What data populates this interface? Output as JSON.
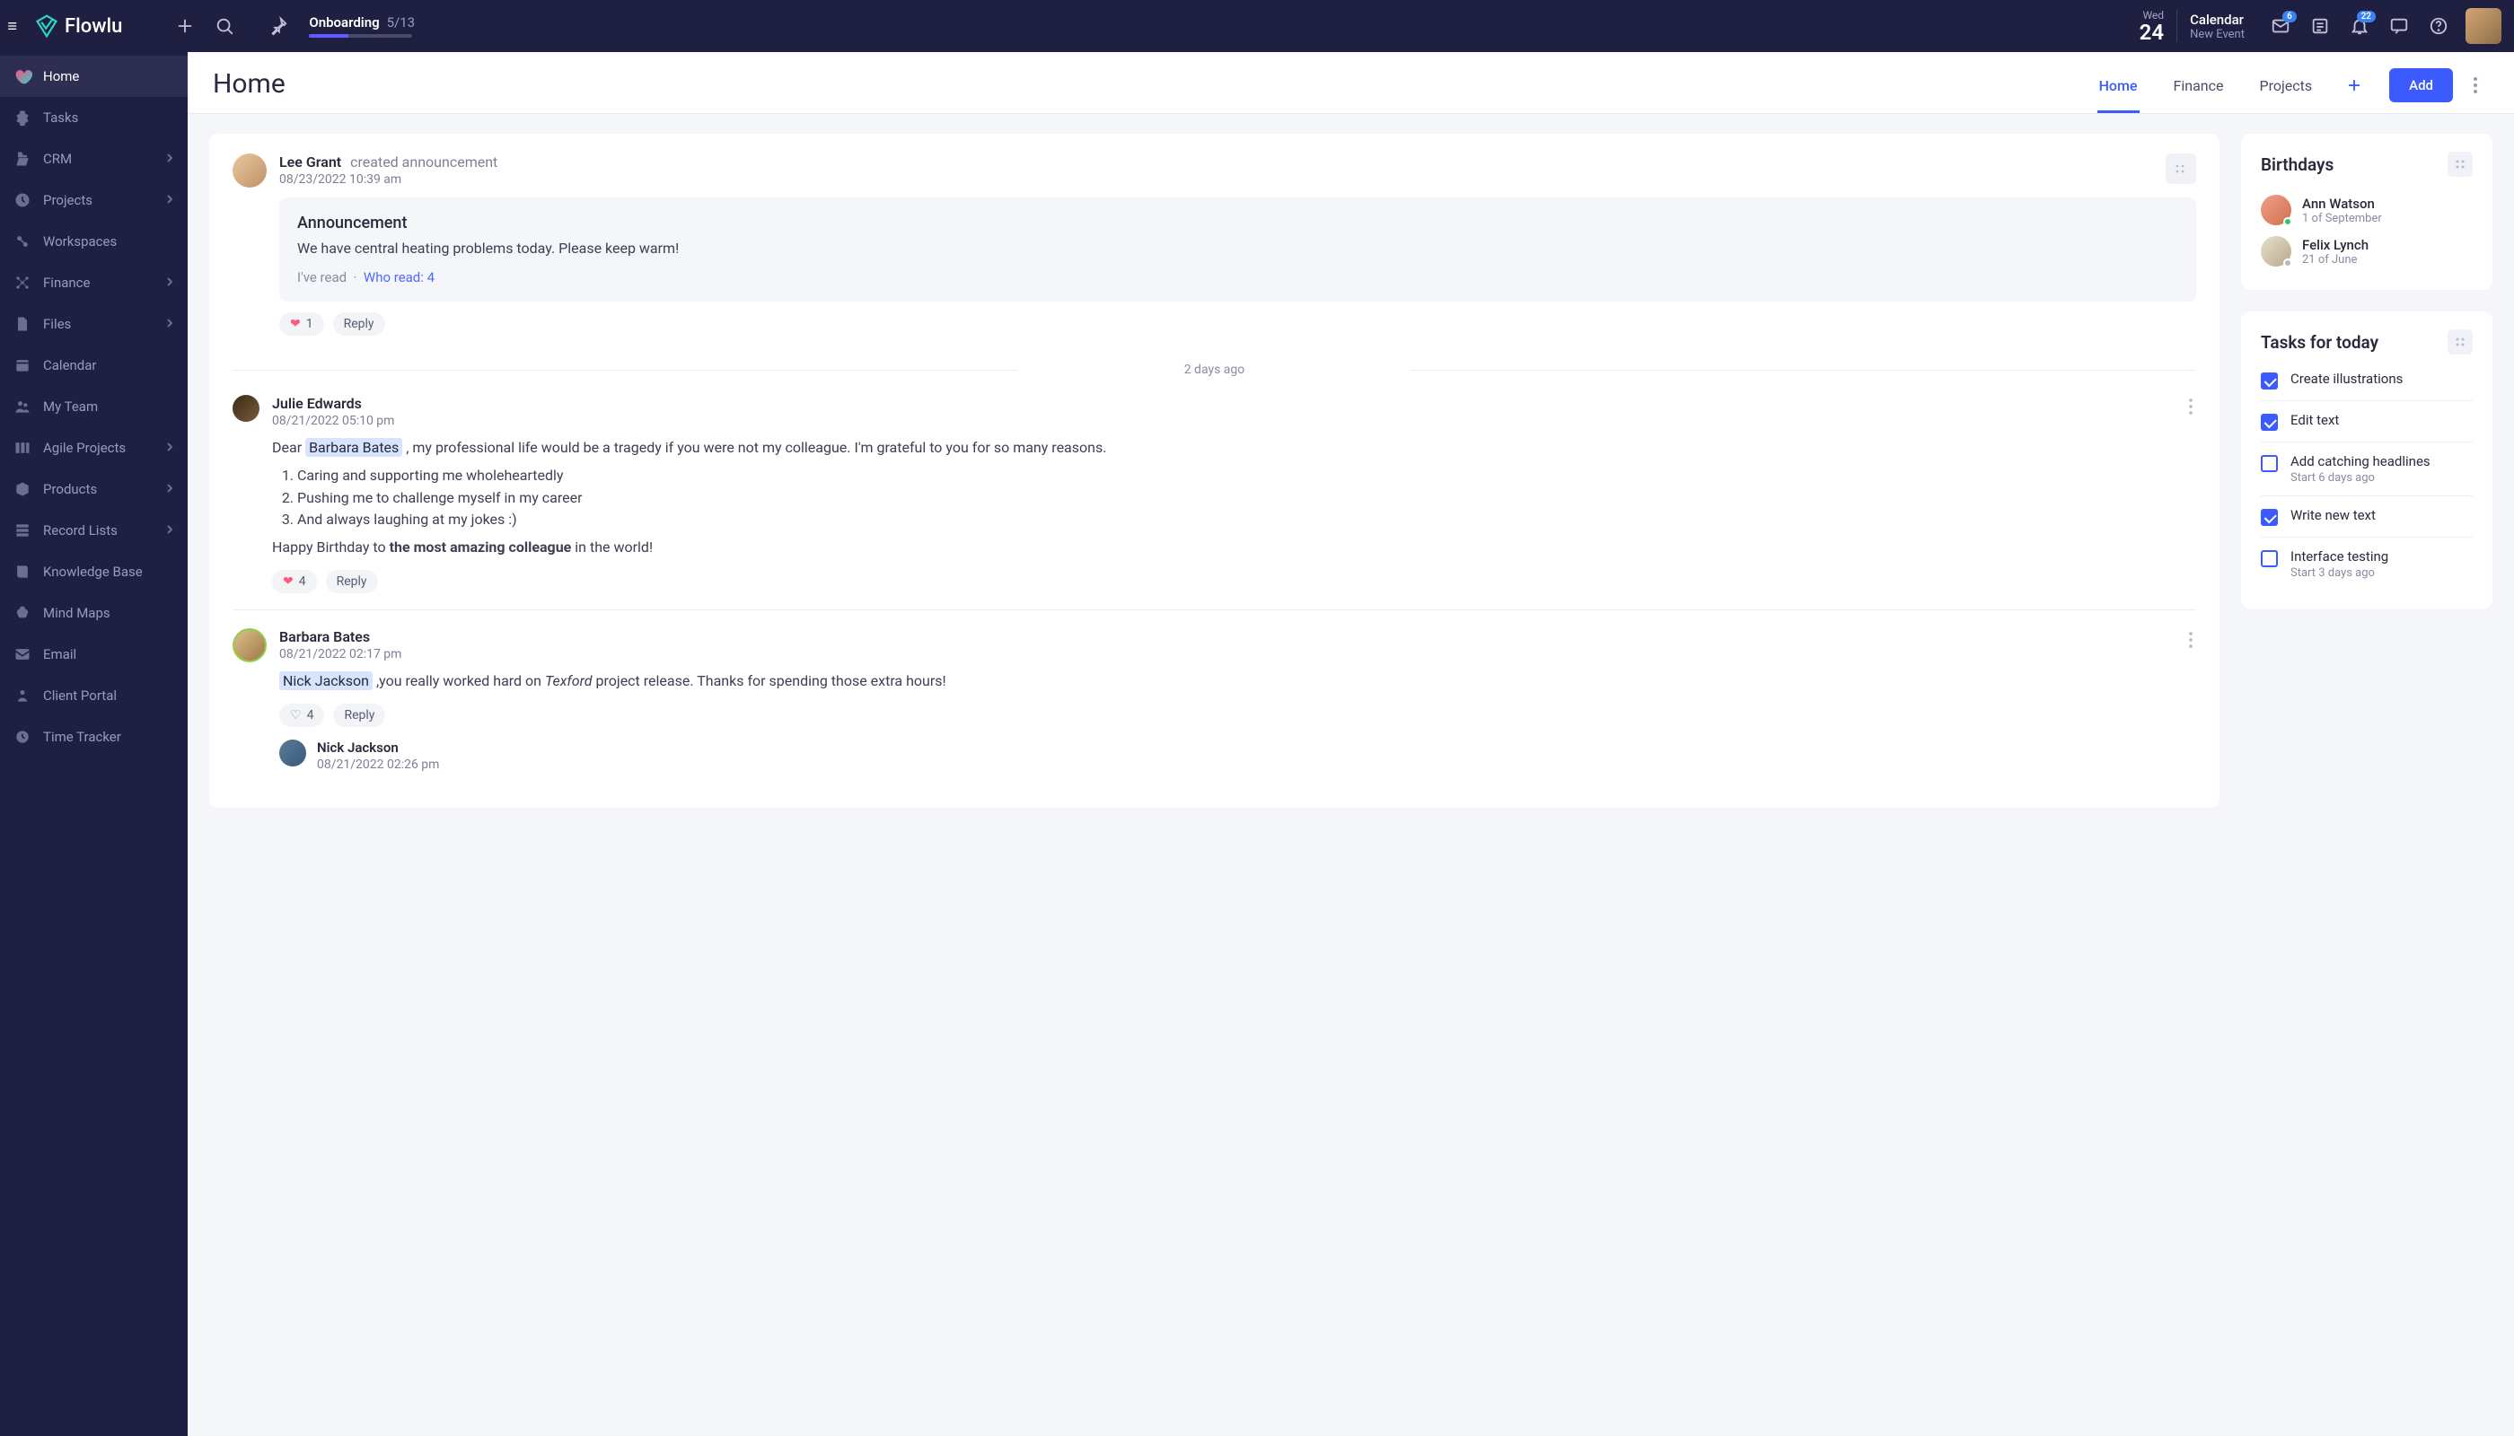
{
  "brand": "Flowlu",
  "onboarding": {
    "title": "Onboarding",
    "count": "5/13"
  },
  "date": {
    "dow": "Wed",
    "num": "24"
  },
  "calendar": {
    "title": "Calendar",
    "sub": "New Event"
  },
  "badges": {
    "inbox": "6",
    "bell": "22"
  },
  "nav": [
    {
      "label": "Home",
      "chev": false
    },
    {
      "label": "Tasks",
      "chev": false
    },
    {
      "label": "CRM",
      "chev": true
    },
    {
      "label": "Projects",
      "chev": true
    },
    {
      "label": "Workspaces",
      "chev": false
    },
    {
      "label": "Finance",
      "chev": true
    },
    {
      "label": "Files",
      "chev": true
    },
    {
      "label": "Calendar",
      "chev": false
    },
    {
      "label": "My Team",
      "chev": false
    },
    {
      "label": "Agile Projects",
      "chev": true
    },
    {
      "label": "Products",
      "chev": true
    },
    {
      "label": "Record Lists",
      "chev": true
    },
    {
      "label": "Knowledge Base",
      "chev": false
    },
    {
      "label": "Mind Maps",
      "chev": false
    },
    {
      "label": "Email",
      "chev": false
    },
    {
      "label": "Client Portal",
      "chev": false
    },
    {
      "label": "Time Tracker",
      "chev": false
    }
  ],
  "page": {
    "title": "Home",
    "tabs": [
      "Home",
      "Finance",
      "Projects"
    ],
    "add": "Add"
  },
  "feed": {
    "divider": "2 days ago",
    "posts": [
      {
        "author": "Lee Grant",
        "action": "created announcement",
        "time": "08/23/2022 10:39 am",
        "announce": {
          "title": "Announcement",
          "body": "We have central heating problems today. Please keep warm!",
          "read_label": "I've read",
          "who_read": "Who read: 4"
        },
        "likes": "1",
        "reply": "Reply"
      },
      {
        "author": "Julie Edwards",
        "time": "08/21/2022 05:10 pm",
        "mention": "Barbara Bates",
        "lead": "Dear ",
        "after_mention": " , my professional life would be a tragedy if you were not my colleague. I'm grateful to you for so many reasons.",
        "bullets": [
          "Caring and supporting me wholeheartedly",
          "Pushing me to challenge myself in my career",
          "And always laughing at my jokes :)"
        ],
        "closer_a": "Happy Birthday to ",
        "closer_b": "the most amazing colleague",
        "closer_c": " in the world!",
        "likes": "4",
        "reply": "Reply"
      },
      {
        "author": "Barbara Bates",
        "time": "08/21/2022 02:17 pm",
        "mention": "Nick Jackson",
        "after_mention_a": " ,you really worked hard on ",
        "italic": "Texford",
        "after_mention_b": " project release. Thanks for spending those extra hours!",
        "likes": "4",
        "reply": "Reply",
        "reply_author": "Nick Jackson",
        "reply_time": "08/21/2022 02:26 pm"
      }
    ]
  },
  "birthdays": {
    "title": "Birthdays",
    "items": [
      {
        "name": "Ann Watson",
        "date": "1 of September",
        "dot": "#33c46f"
      },
      {
        "name": "Felix Lynch",
        "date": "21 of June",
        "dot": "#b7b8c6"
      }
    ]
  },
  "tasks_widget": {
    "title": "Tasks for today",
    "items": [
      {
        "title": "Create illustrations",
        "done": true
      },
      {
        "title": "Edit text",
        "done": true
      },
      {
        "title": "Add catching headlines",
        "sub": "Start 6 days ago",
        "done": false
      },
      {
        "title": "Write new text",
        "done": true
      },
      {
        "title": "Interface testing",
        "sub": "Start 3 days ago",
        "done": false
      }
    ]
  }
}
